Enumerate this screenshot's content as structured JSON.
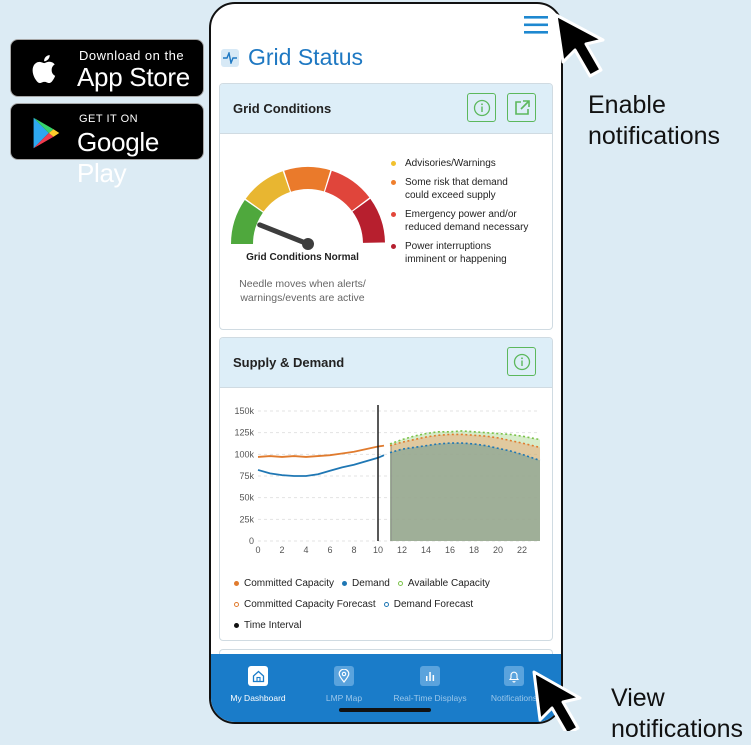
{
  "store_badges": {
    "apple": {
      "small": "Download on the",
      "big": "App Store"
    },
    "google": {
      "small": "GET IT ON",
      "big": "Google Play"
    }
  },
  "annotations": {
    "enable": [
      "Enable",
      "notifications"
    ],
    "view": [
      "View",
      "notifications"
    ]
  },
  "page": {
    "title": "Grid Status",
    "title_icon": "pulse-icon",
    "menu_icon": "hamburger-menu-icon"
  },
  "grid_conditions": {
    "title": "Grid Conditions",
    "info_icon": "info-icon",
    "external_icon": "external-link-icon",
    "status": "Grid Conditions Normal",
    "note": [
      "Needle moves when alerts/",
      "warnings/events are active"
    ],
    "gauge_level": 0.12,
    "legend": [
      {
        "color": "#f2c12e",
        "lines": [
          "Advisories/Warnings"
        ]
      },
      {
        "color": "#ef7f2d",
        "lines": [
          "Some risk that demand",
          "could exceed supply"
        ]
      },
      {
        "color": "#e2463a",
        "lines": [
          "Emergency power and/or",
          "reduced demand necessary"
        ]
      },
      {
        "color": "#b5202f",
        "lines": [
          "Power interruptions",
          "imminent or happening"
        ]
      }
    ]
  },
  "supply_demand": {
    "title": "Supply & Demand",
    "info_icon": "info-icon",
    "legend_rows": [
      [
        {
          "label": "Committed Capacity",
          "color": "#e07b2e",
          "style": "filled"
        },
        {
          "label": "Demand",
          "color": "#1f77b4",
          "style": "filled"
        },
        {
          "label": "Available Capacity",
          "color": "#7bc24a",
          "style": "hollow"
        }
      ],
      [
        {
          "label": "Committed Capacity Forecast",
          "color": "#e07b2e",
          "style": "hollow"
        },
        {
          "label": "Demand Forecast",
          "color": "#1f77b4",
          "style": "hollow"
        }
      ],
      [
        {
          "label": "Time Interval",
          "color": "#111111",
          "style": "filled"
        }
      ]
    ]
  },
  "chart_data": {
    "type": "line",
    "title": "",
    "xlabel": "",
    "ylabel": "",
    "x_ticks": [
      "0",
      "2",
      "4",
      "6",
      "8",
      "10",
      "12",
      "14",
      "16",
      "18",
      "20",
      "22"
    ],
    "y_ticks": [
      "0",
      "25k",
      "50k",
      "75k",
      "100k",
      "125k",
      "150k"
    ],
    "xlim": [
      0,
      23.5
    ],
    "ylim": [
      0,
      150000
    ],
    "time_interval_x": 10,
    "forecast_start_x": 11.1,
    "series": [
      {
        "name": "Committed Capacity",
        "color": "#e07b2e",
        "style": "solid",
        "x": [
          0,
          1,
          2,
          3,
          4,
          5,
          6,
          7,
          8,
          9,
          10,
          10.5
        ],
        "y": [
          97000,
          98000,
          97000,
          98000,
          97000,
          98000,
          99000,
          101000,
          103000,
          106000,
          109000,
          110000
        ]
      },
      {
        "name": "Demand",
        "color": "#1f77b4",
        "style": "solid",
        "x": [
          0,
          1,
          2,
          3,
          4,
          5,
          6,
          7,
          8,
          9,
          10,
          10.5
        ],
        "y": [
          82000,
          78000,
          76000,
          75000,
          75000,
          77000,
          81000,
          85000,
          88000,
          92000,
          96000,
          99000
        ]
      },
      {
        "name": "Available Capacity",
        "color": "#7bc24a",
        "style": "dotted",
        "x": [
          11,
          12,
          13,
          14,
          15,
          16,
          17,
          18,
          19,
          20,
          21,
          22,
          23.5
        ],
        "y": [
          112000,
          117000,
          121000,
          124000,
          126000,
          126000,
          127000,
          126000,
          125000,
          124000,
          123000,
          121000,
          117000
        ]
      },
      {
        "name": "Committed Capacity Forecast",
        "color": "#e07b2e",
        "style": "dotted",
        "x": [
          11,
          12,
          13,
          14,
          15,
          16,
          17,
          18,
          19,
          20,
          21,
          22,
          23.5
        ],
        "y": [
          110000,
          114000,
          117000,
          120000,
          122000,
          123000,
          123000,
          122000,
          121000,
          119000,
          116000,
          113000,
          108000
        ]
      },
      {
        "name": "Demand Forecast",
        "color": "#1f77b4",
        "style": "dotted",
        "x": [
          11,
          12,
          13,
          14,
          15,
          16,
          17,
          18,
          19,
          20,
          21,
          22,
          23.5
        ],
        "y": [
          102000,
          106000,
          108000,
          110000,
          112000,
          113000,
          113000,
          112000,
          110000,
          107000,
          104000,
          100000,
          93000
        ]
      }
    ]
  },
  "tabs": [
    {
      "label": "My Dashboard",
      "icon": "home-icon",
      "active": true
    },
    {
      "label": "LMP Map",
      "icon": "map-pin-icon",
      "active": false
    },
    {
      "label": "Real-Time Displays",
      "icon": "bar-chart-icon",
      "active": false
    },
    {
      "label": "Notifications",
      "icon": "bell-icon",
      "active": false
    }
  ]
}
